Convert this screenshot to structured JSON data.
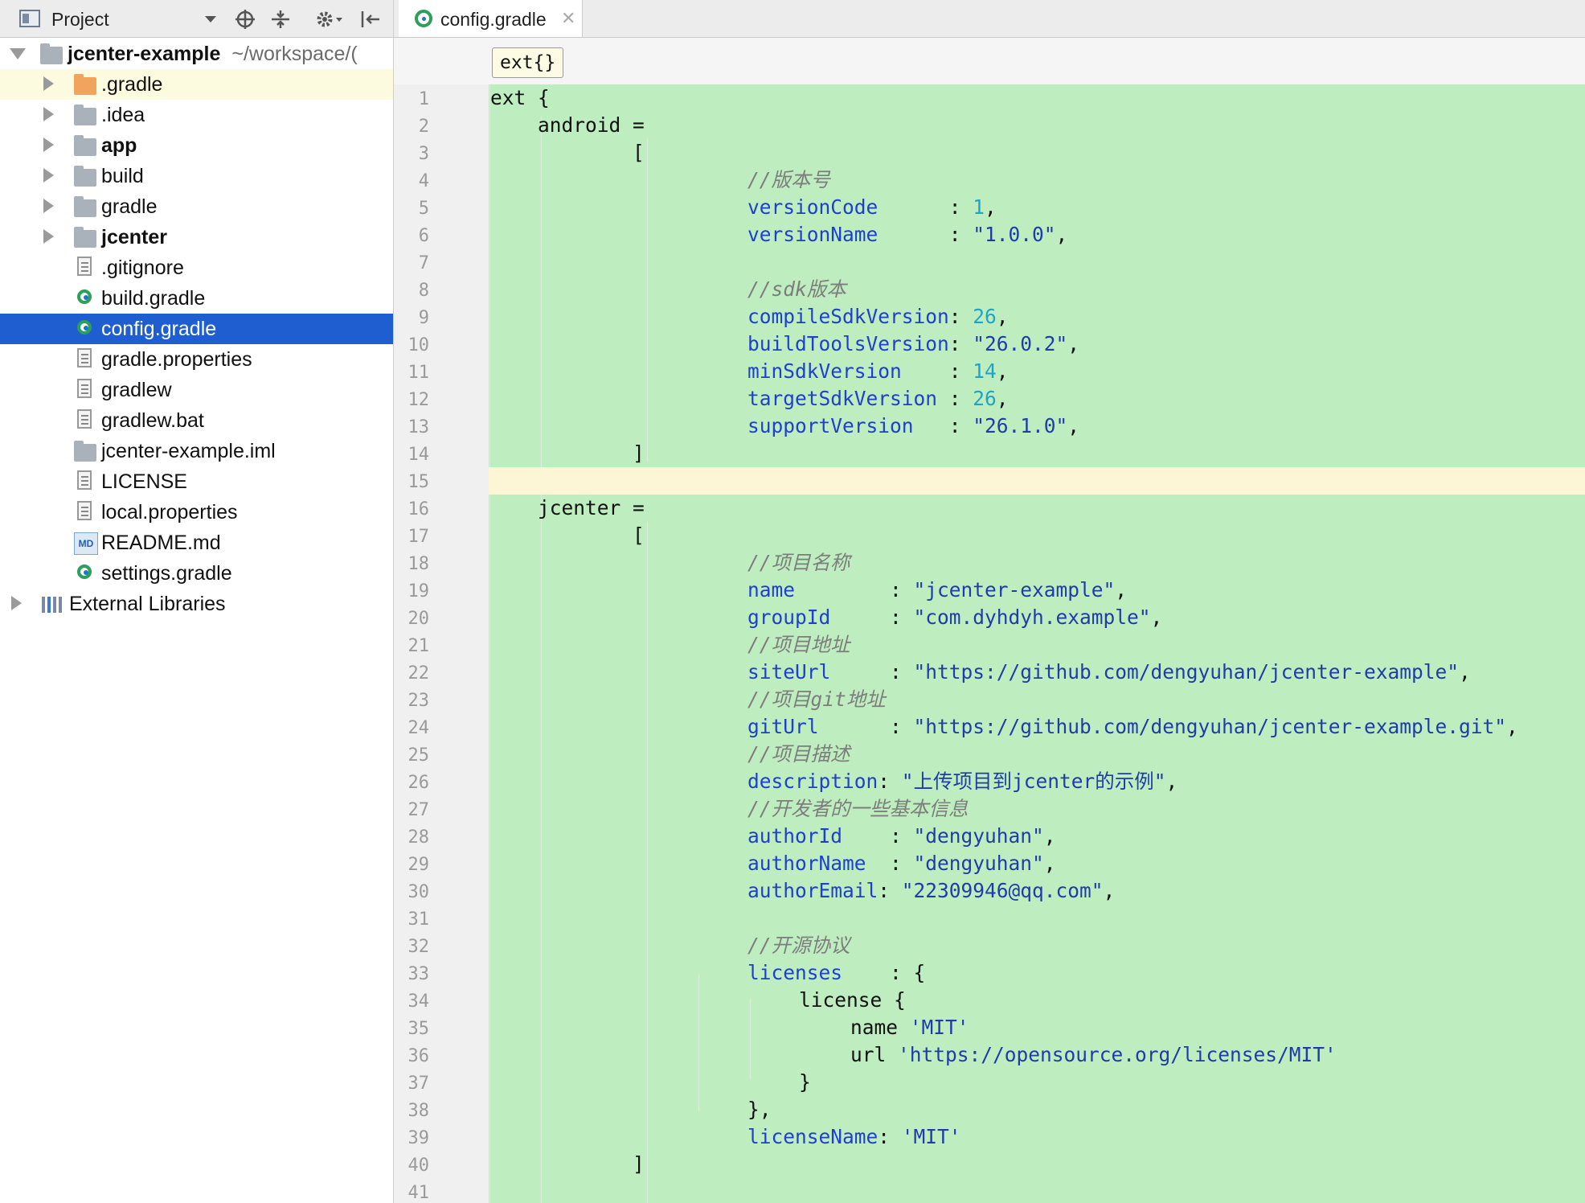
{
  "project_panel": {
    "title": "Project",
    "tree": [
      {
        "label": "jcenter-example",
        "path": "~/workspace/(",
        "bold": true
      },
      {
        "label": ".gradle"
      },
      {
        "label": ".idea"
      },
      {
        "label": "app",
        "bold": true
      },
      {
        "label": "build"
      },
      {
        "label": "gradle"
      },
      {
        "label": "jcenter",
        "bold": true
      },
      {
        "label": ".gitignore"
      },
      {
        "label": "build.gradle"
      },
      {
        "label": "config.gradle",
        "selected": true
      },
      {
        "label": "gradle.properties"
      },
      {
        "label": "gradlew"
      },
      {
        "label": "gradlew.bat"
      },
      {
        "label": "jcenter-example.iml"
      },
      {
        "label": "LICENSE"
      },
      {
        "label": "local.properties"
      },
      {
        "label": "README.md",
        "icon_text": "MD"
      },
      {
        "label": "settings.gradle"
      },
      {
        "label": "External Libraries"
      }
    ]
  },
  "editor": {
    "tab_label": "config.gradle",
    "breadcrumb": "ext{}",
    "line_numbers": [
      "1",
      "2",
      "3",
      "4",
      "5",
      "6",
      "7",
      "8",
      "9",
      "10",
      "11",
      "12",
      "13",
      "14",
      "15",
      "16",
      "17",
      "18",
      "19",
      "20",
      "21",
      "22",
      "23",
      "24",
      "25",
      "26",
      "27",
      "28",
      "29",
      "30",
      "31",
      "32",
      "33",
      "34",
      "35",
      "36",
      "37",
      "38",
      "39",
      "40",
      "41"
    ],
    "code": {
      "l1": "ext {",
      "l2": "    android =",
      "l3": "            [",
      "l4": "//版本号",
      "l5_key": "versionCode",
      "l5_val": "1",
      "l6_key": "versionName",
      "l6_val": "\"1.0.0\"",
      "l8_pre": "//",
      "l8_sdk": "sdk",
      "l8_post": "版本",
      "l9_key": "compileSdkVersion",
      "l9_val": "26",
      "l10_key": "buildToolsVersion",
      "l10_val": "\"26.0.2\"",
      "l11_key": "minSdkVersion",
      "l11_val": "14",
      "l12_key": "targetSdkVersion",
      "l12_val": "26",
      "l13_key": "supportVersion",
      "l13_val": "\"26.1.0\"",
      "l14": "            ]",
      "l16": "    jcenter =",
      "l17": "            [",
      "l18": "//项目名称",
      "l19_key": "name",
      "l19_val": "\"jcenter-example\"",
      "l20_key": "groupId",
      "l20_val": "\"com.dyhdyh.example\"",
      "l21": "//项目地址",
      "l22_key": "siteUrl",
      "l22_val": "\"https://github.com/dengyuhan/jcenter-example\"",
      "l23_pre": "//项目",
      "l23_git": "git",
      "l23_post": "地址",
      "l24_key": "gitUrl",
      "l24_val": "\"https://github.com/dengyuhan/jcenter-example.git\"",
      "l25": "//项目描述",
      "l26_key": "description",
      "l26_val": "\"上传项目到jcenter的示例\"",
      "l27": "//开发者的一些基本信息",
      "l28_key": "authorId",
      "l28_val": "\"dengyuhan\"",
      "l29_key": "authorName",
      "l29_val": "\"dengyuhan\"",
      "l30_key": "authorEmail",
      "l30_val": "\"22309946@qq.com\"",
      "l32": "//开源协议",
      "l33_key": "licenses",
      "l33_rest": "    : {",
      "l34": "license {",
      "l35_key": "name",
      "l35_val": "'MIT'",
      "l36_key": "url",
      "l36_val": "'https://opensource.org/licenses/MIT'",
      "l37": "}",
      "l38": "},",
      "l39_key": "licenseName",
      "l39_val": "'MIT'",
      "l40": "            ]"
    }
  }
}
